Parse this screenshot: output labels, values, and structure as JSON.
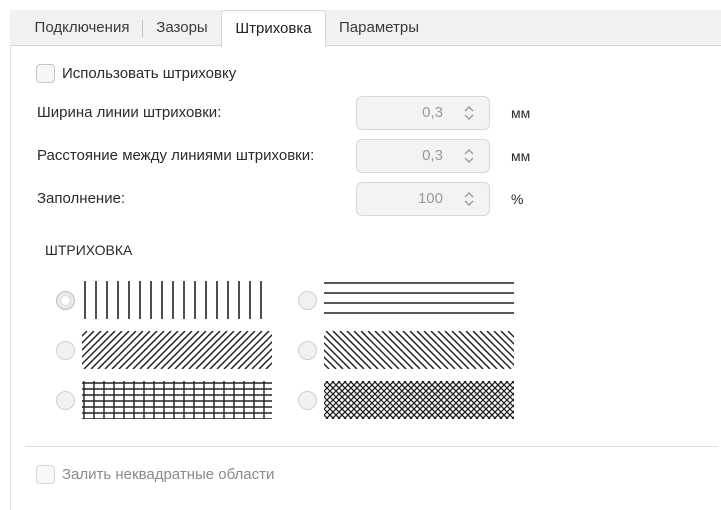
{
  "tabs": [
    {
      "label": "Подключения",
      "active": false
    },
    {
      "label": "Зазоры",
      "active": false
    },
    {
      "label": "Штриховка",
      "active": true
    },
    {
      "label": "Параметры",
      "active": false
    }
  ],
  "use_hatching": {
    "label": "Использовать штриховку",
    "checked": false
  },
  "fields": {
    "line_width": {
      "label": "Ширина линии штриховки:",
      "value": "0,3",
      "unit": "мм"
    },
    "line_spacing": {
      "label": "Расстояние между линиями штриховки:",
      "value": "0,3",
      "unit": "мм"
    },
    "fill": {
      "label": "Заполнение:",
      "value": "100",
      "unit": "%"
    }
  },
  "hatch_section": {
    "title": "ШТРИХОВКА"
  },
  "patterns": [
    {
      "name": "vertical",
      "selected": true
    },
    {
      "name": "horizontal",
      "selected": false
    },
    {
      "name": "diagonal-forward",
      "selected": false
    },
    {
      "name": "diagonal-back",
      "selected": false
    },
    {
      "name": "grid",
      "selected": false
    },
    {
      "name": "cross-diagonal",
      "selected": false
    }
  ],
  "fill_non_square": {
    "label": "Залить неквадратные области",
    "checked": false
  }
}
